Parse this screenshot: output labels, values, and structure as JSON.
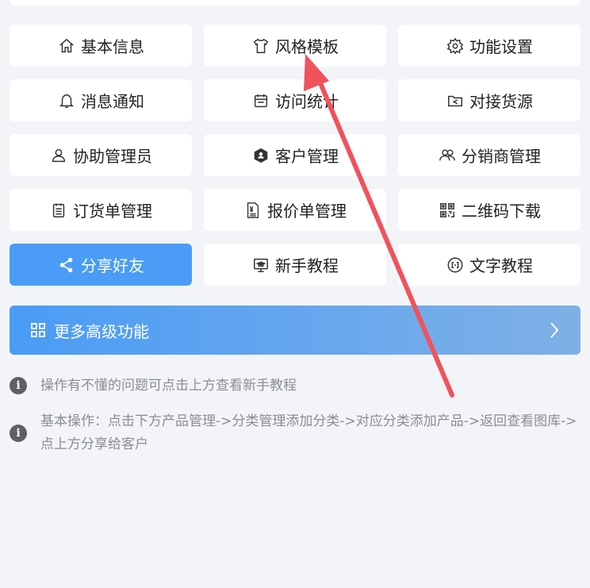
{
  "tiles": [
    {
      "label": "基本信息",
      "icon": "home-icon"
    },
    {
      "label": "风格模板",
      "icon": "tshirt-icon"
    },
    {
      "label": "功能设置",
      "icon": "gear-icon"
    },
    {
      "label": "消息通知",
      "icon": "bell-icon"
    },
    {
      "label": "访问统计",
      "icon": "calendar-icon"
    },
    {
      "label": "对接货源",
      "icon": "share-folder-icon"
    },
    {
      "label": "协助管理员",
      "icon": "user-icon"
    },
    {
      "label": "客户管理",
      "icon": "customer-hex-icon"
    },
    {
      "label": "分销商管理",
      "icon": "users-icon"
    },
    {
      "label": "订货单管理",
      "icon": "clipboard-icon"
    },
    {
      "label": "报价单管理",
      "icon": "price-doc-icon"
    },
    {
      "label": "二维码下载",
      "icon": "qrcode-icon"
    },
    {
      "label": "分享好友",
      "icon": "share-icon",
      "active": true
    },
    {
      "label": "新手教程",
      "icon": "monitor-graduate-icon"
    },
    {
      "label": "文字教程",
      "icon": "text-circle-icon"
    }
  ],
  "more": {
    "label": "更多高级功能",
    "icon": "grid-icon"
  },
  "tips": [
    {
      "text": "操作有不懂的问题可点击上方查看新手教程"
    },
    {
      "text": "基本操作：点击下方产品管理->分类管理添加分类->对应分类添加产品->返回查看图库->点上方分享给客户"
    }
  ],
  "colors": {
    "accent": "#4a9cf6",
    "annotation": "#f0525b",
    "background": "#f3f4f8"
  }
}
